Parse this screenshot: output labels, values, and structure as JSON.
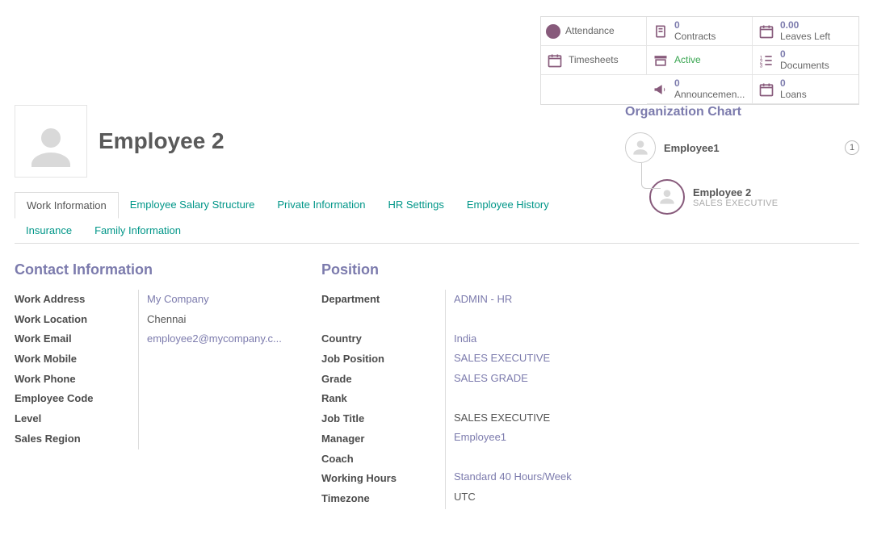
{
  "stats": {
    "attendance": "Attendance",
    "contracts_num": "0",
    "contracts_label": "Contracts",
    "leaves_num": "0.00",
    "leaves_label": "Leaves Left",
    "timesheets": "Timesheets",
    "active": "Active",
    "documents_num": "0",
    "documents_label": "Documents",
    "announcements_num": "0",
    "announcements_label": "Announcemen...",
    "loans_num": "0",
    "loans_label": "Loans"
  },
  "header": {
    "name": "Employee 2"
  },
  "tabs": {
    "work_info": "Work Information",
    "salary": "Employee Salary Structure",
    "private": "Private Information",
    "hr": "HR Settings",
    "history": "Employee History",
    "insurance": "Insurance",
    "family": "Family Information"
  },
  "contact": {
    "title": "Contact Information",
    "labels": {
      "work_address": "Work Address",
      "work_location": "Work Location",
      "work_email": "Work Email",
      "work_mobile": "Work Mobile",
      "work_phone": "Work Phone",
      "employee_code": "Employee Code",
      "level": "Level",
      "sales_region": "Sales Region"
    },
    "values": {
      "work_address": "My Company",
      "work_location": "Chennai",
      "work_email": "employee2@mycompany.c..."
    }
  },
  "position": {
    "title": "Position",
    "labels": {
      "department": "Department",
      "country": "Country",
      "job_position": "Job Position",
      "grade": "Grade",
      "rank": "Rank",
      "job_title": "Job Title",
      "manager": "Manager",
      "coach": "Coach",
      "working_hours": "Working Hours",
      "timezone": "Timezone"
    },
    "values": {
      "department": "ADMIN - HR",
      "country": "India",
      "job_position": "SALES EXECUTIVE",
      "grade": "SALES GRADE",
      "job_title": "SALES EXECUTIVE",
      "manager": "Employee1",
      "working_hours": "Standard 40 Hours/Week",
      "timezone": "UTC"
    }
  },
  "org": {
    "title": "Organization Chart",
    "parent_name": "Employee1",
    "parent_count": "1",
    "current_name": "Employee 2",
    "current_role": "SALES EXECUTIVE"
  }
}
